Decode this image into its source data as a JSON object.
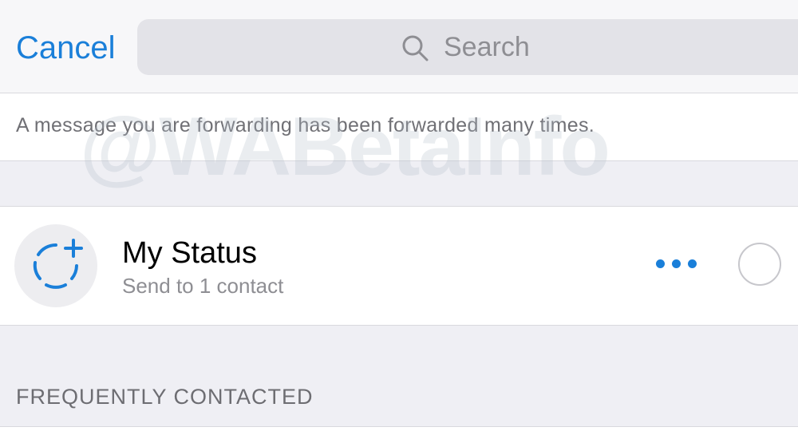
{
  "header": {
    "cancel_label": "Cancel",
    "search_placeholder": "Search"
  },
  "notice": {
    "text": "A message you are forwarding has been forwarded many times."
  },
  "watermark": {
    "text": "@WABetaInfo"
  },
  "status": {
    "title": "My Status",
    "subtitle": "Send to 1 contact"
  },
  "sections": {
    "frequently_contacted": "FREQUENTLY CONTACTED"
  },
  "colors": {
    "accent": "#1a7fd9",
    "background": "#efeff4",
    "secondary_text": "#8e8e93"
  },
  "icons": [
    "search-icon",
    "status-add-icon",
    "more-icon",
    "select-circle-icon"
  ]
}
